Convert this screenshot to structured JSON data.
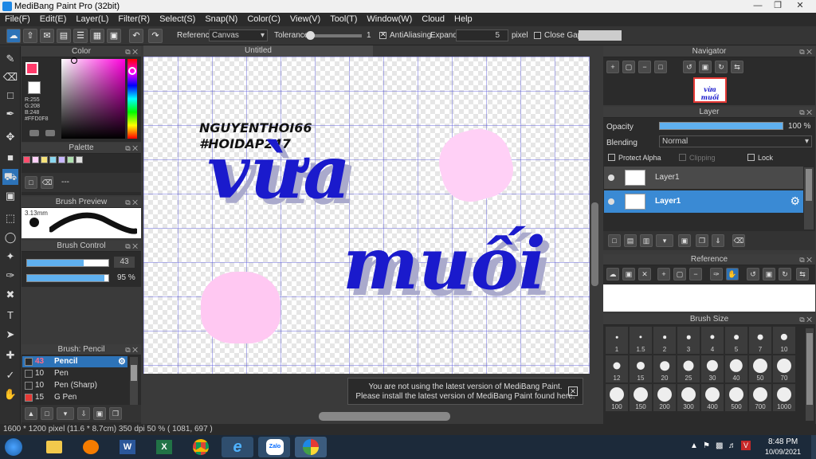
{
  "window": {
    "title": "MediBang Paint Pro (32bit)"
  },
  "menu": [
    "File(F)",
    "Edit(E)",
    "Layer(L)",
    "Filter(R)",
    "Select(S)",
    "Snap(N)",
    "Color(C)",
    "View(V)",
    "Tool(T)",
    "Window(W)",
    "Cloud",
    "Help"
  ],
  "toolbar": {
    "reference_label": "Reference",
    "reference_value": "Canvas",
    "tolerance_label": "Tolerance",
    "tolerance_value": "1",
    "antialiasing_label": "AntiAliasing",
    "expand_label": "Expand",
    "expand_value": "5",
    "expand_unit": "pixel",
    "close_gaps_label": "Close Gaps"
  },
  "color_panel": {
    "title": "Color",
    "r": "R:255",
    "g": "G:208",
    "b": "B:248",
    "hex": "#FFD0F8",
    "primary": "#ff3a6a",
    "secondary": "#ffd0f8"
  },
  "palette_panel": {
    "title": "Palette",
    "swatches": [
      "#ff4d6d",
      "#ffd0f8",
      "#f7e37a",
      "#8ad7f0",
      "#c8b8ff",
      "#b0e0b0",
      "#e0e0e0"
    ],
    "footer": "---"
  },
  "brush_preview": {
    "title": "Brush Preview",
    "size": "3.13mm"
  },
  "brush_control": {
    "title": "Brush Control",
    "size": "43",
    "size_fraction": 0.7,
    "opacity": "95 %",
    "opacity_fraction": 0.95
  },
  "brush_panel": {
    "title": "Brush: Pencil",
    "items": [
      {
        "num": "43",
        "name": "Pencil",
        "color": "#2b2b2b",
        "selected": true
      },
      {
        "num": "10",
        "name": "Pen",
        "color": "#2b2b2b"
      },
      {
        "num": "10",
        "name": "Pen (Sharp)",
        "color": "#2b2b2b"
      },
      {
        "num": "15",
        "name": "G Pen",
        "color": "#e53935"
      }
    ]
  },
  "document": {
    "tab": "Untitled"
  },
  "artwork": {
    "credit1": "NGUYENTHOI66",
    "credit2": "#HOIDAP247",
    "word1": "vừa",
    "word2": "muối"
  },
  "notice": {
    "line1": "You are not using the latest version of MediBang Paint.",
    "line2": "Please install the latest version of MediBang Paint found here."
  },
  "navigator": {
    "title": "Navigator",
    "thumb_text": "vừa muối"
  },
  "layer_panel": {
    "title": "Layer",
    "opacity_label": "Opacity",
    "opacity_value": "100 %",
    "opacity_fraction": 1.0,
    "blending_label": "Blending",
    "blending_value": "Normal",
    "protect_alpha": "Protect Alpha",
    "clipping": "Clipping",
    "lock": "Lock",
    "layers": [
      {
        "name": "Layer1",
        "selected": false
      },
      {
        "name": "Layer1",
        "selected": true
      }
    ]
  },
  "reference_panel": {
    "title": "Reference"
  },
  "brush_size_panel": {
    "title": "Brush Size",
    "sizes": [
      "1",
      "1.5",
      "2",
      "3",
      "4",
      "5",
      "7",
      "10",
      "12",
      "15",
      "20",
      "25",
      "30",
      "40",
      "50",
      "70",
      "100",
      "150",
      "200",
      "300",
      "400",
      "500",
      "700",
      "1000"
    ]
  },
  "status": {
    "text": "1600 * 1200 pixel  (11.6 * 8.7cm)  350 dpi  50 %  ( 1081, 697 )"
  },
  "taskbar": {
    "time": "8:48 PM",
    "date": "10/09/2021",
    "apps": [
      "file-explorer",
      "media-player",
      "word",
      "excel",
      "chrome",
      "internet-explorer",
      "zalo",
      "medibang"
    ]
  }
}
